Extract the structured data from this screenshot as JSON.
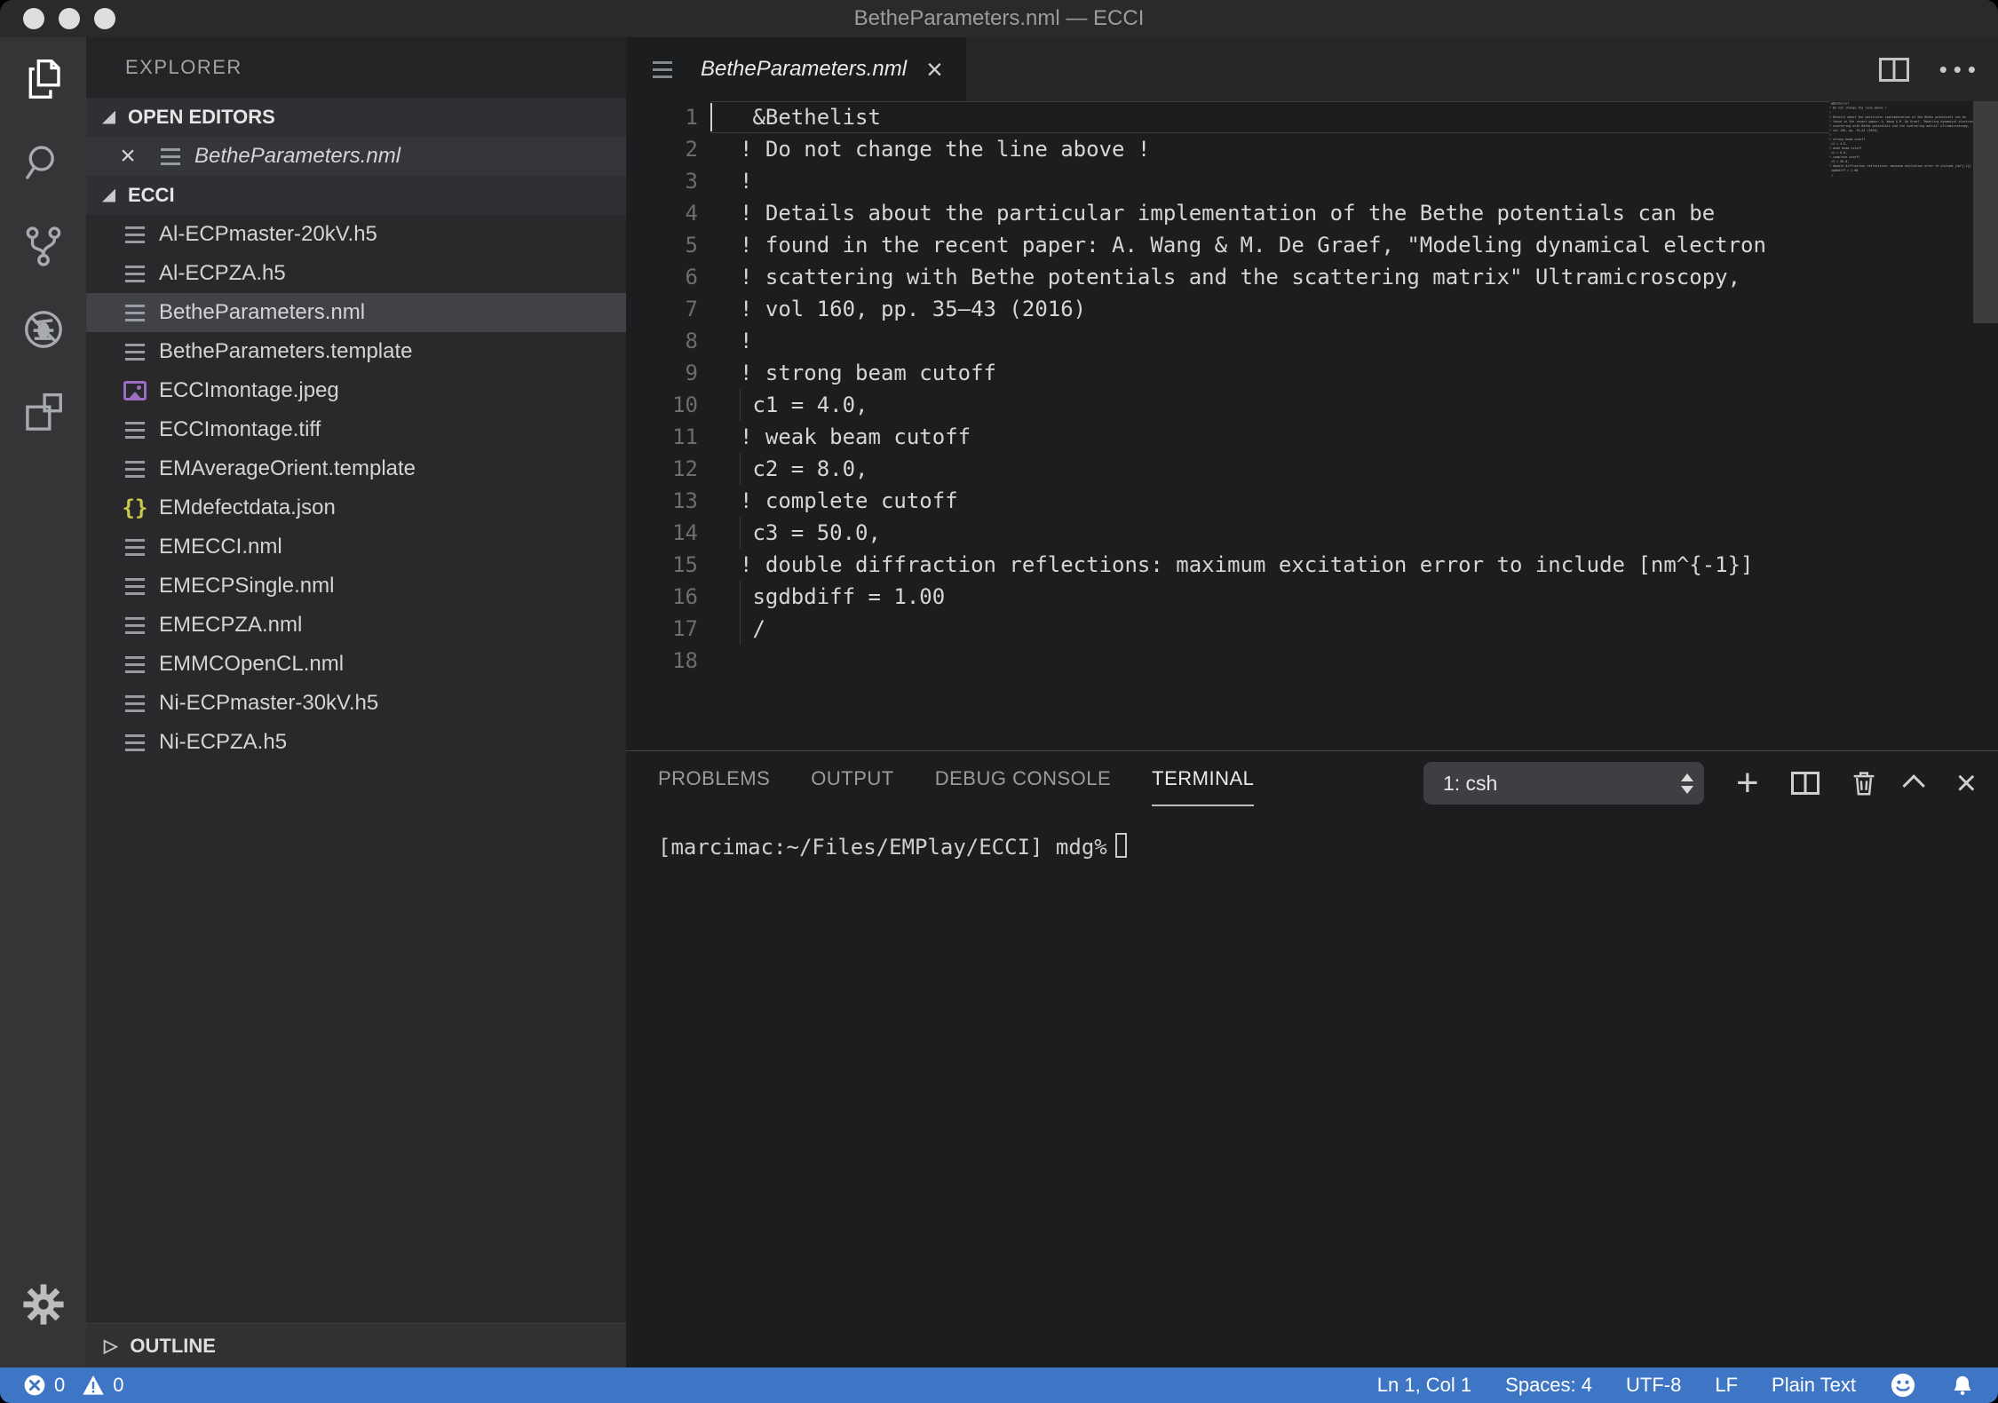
{
  "window": {
    "title": "BetheParameters.nml — ECCI"
  },
  "activity_bar": {
    "items": [
      {
        "name": "explorer",
        "active": true
      },
      {
        "name": "search",
        "active": false
      },
      {
        "name": "source-control",
        "active": false
      },
      {
        "name": "debug-disabled",
        "active": false
      },
      {
        "name": "extensions",
        "active": false
      }
    ],
    "settings": "settings-gear"
  },
  "sidebar": {
    "title": "EXPLORER",
    "open_editors": {
      "label": "OPEN EDITORS",
      "items": [
        {
          "name": "BetheParameters.nml",
          "icon": "file-lines-icon"
        }
      ]
    },
    "folder": {
      "label": "ECCI",
      "files": [
        {
          "name": "Al-ECPmaster-20kV.h5",
          "icon": "file-lines-icon",
          "selected": false
        },
        {
          "name": "Al-ECPZA.h5",
          "icon": "file-lines-icon",
          "selected": false
        },
        {
          "name": "BetheParameters.nml",
          "icon": "file-lines-icon",
          "selected": true
        },
        {
          "name": "BetheParameters.template",
          "icon": "file-lines-icon",
          "selected": false
        },
        {
          "name": "ECCImontage.jpeg",
          "icon": "image-icon",
          "selected": false
        },
        {
          "name": "ECCImontage.tiff",
          "icon": "file-lines-icon",
          "selected": false
        },
        {
          "name": "EMAverageOrient.template",
          "icon": "file-lines-icon",
          "selected": false
        },
        {
          "name": "EMdefectdata.json",
          "icon": "json-icon",
          "selected": false
        },
        {
          "name": "EMECCI.nml",
          "icon": "file-lines-icon",
          "selected": false
        },
        {
          "name": "EMECPSingle.nml",
          "icon": "file-lines-icon",
          "selected": false
        },
        {
          "name": "EMECPZA.nml",
          "icon": "file-lines-icon",
          "selected": false
        },
        {
          "name": "EMMCOpenCL.nml",
          "icon": "file-lines-icon",
          "selected": false
        },
        {
          "name": "Ni-ECPmaster-30kV.h5",
          "icon": "file-lines-icon",
          "selected": false
        },
        {
          "name": "Ni-ECPZA.h5",
          "icon": "file-lines-icon",
          "selected": false
        }
      ]
    },
    "outline": {
      "label": "OUTLINE"
    }
  },
  "editor": {
    "tab": {
      "name": "BetheParameters.nml"
    },
    "lines": [
      {
        "num": 1,
        "text": " &Bethelist"
      },
      {
        "num": 2,
        "text": "! Do not change the line above !"
      },
      {
        "num": 3,
        "text": "!"
      },
      {
        "num": 4,
        "text": "! Details about the particular implementation of the Bethe potentials can be"
      },
      {
        "num": 5,
        "text": "! found in the recent paper: A. Wang & M. De Graef, \"Modeling dynamical electron"
      },
      {
        "num": 6,
        "text": "! scattering with Bethe potentials and the scattering matrix\" Ultramicroscopy,"
      },
      {
        "num": 7,
        "text": "! vol 160, pp. 35–43 (2016)"
      },
      {
        "num": 8,
        "text": "!"
      },
      {
        "num": 9,
        "text": "! strong beam cutoff"
      },
      {
        "num": 10,
        "text": " c1 = 4.0,"
      },
      {
        "num": 11,
        "text": "! weak beam cutoff"
      },
      {
        "num": 12,
        "text": " c2 = 8.0,"
      },
      {
        "num": 13,
        "text": "! complete cutoff"
      },
      {
        "num": 14,
        "text": " c3 = 50.0,"
      },
      {
        "num": 15,
        "text": "! double diffraction reflections: maximum excitation error to include [nm^{-1}]"
      },
      {
        "num": 16,
        "text": " sgdbdiff = 1.00"
      },
      {
        "num": 17,
        "text": " /"
      },
      {
        "num": 18,
        "text": ""
      }
    ]
  },
  "panel": {
    "tabs": [
      "PROBLEMS",
      "OUTPUT",
      "DEBUG CONSOLE",
      "TERMINAL"
    ],
    "active_tab": "TERMINAL",
    "shell_select": "1: csh",
    "terminal_prompt": "[marcimac:~/Files/EMPlay/ECCI] mdg%"
  },
  "status_bar": {
    "errors": "0",
    "warnings": "0",
    "cursor": "Ln 1, Col 1",
    "indent": "Spaces: 4",
    "encoding": "UTF-8",
    "eol": "LF",
    "language": "Plain Text"
  },
  "colors": {
    "status_bar": "#3e76c5",
    "editor_bg": "#1c1d1e",
    "sidebar_bg": "#29292c",
    "activity_bar_bg": "#353538",
    "selected_row": "#414148",
    "json_icon": "#c9c94b",
    "image_icon": "#9b6fc0"
  }
}
